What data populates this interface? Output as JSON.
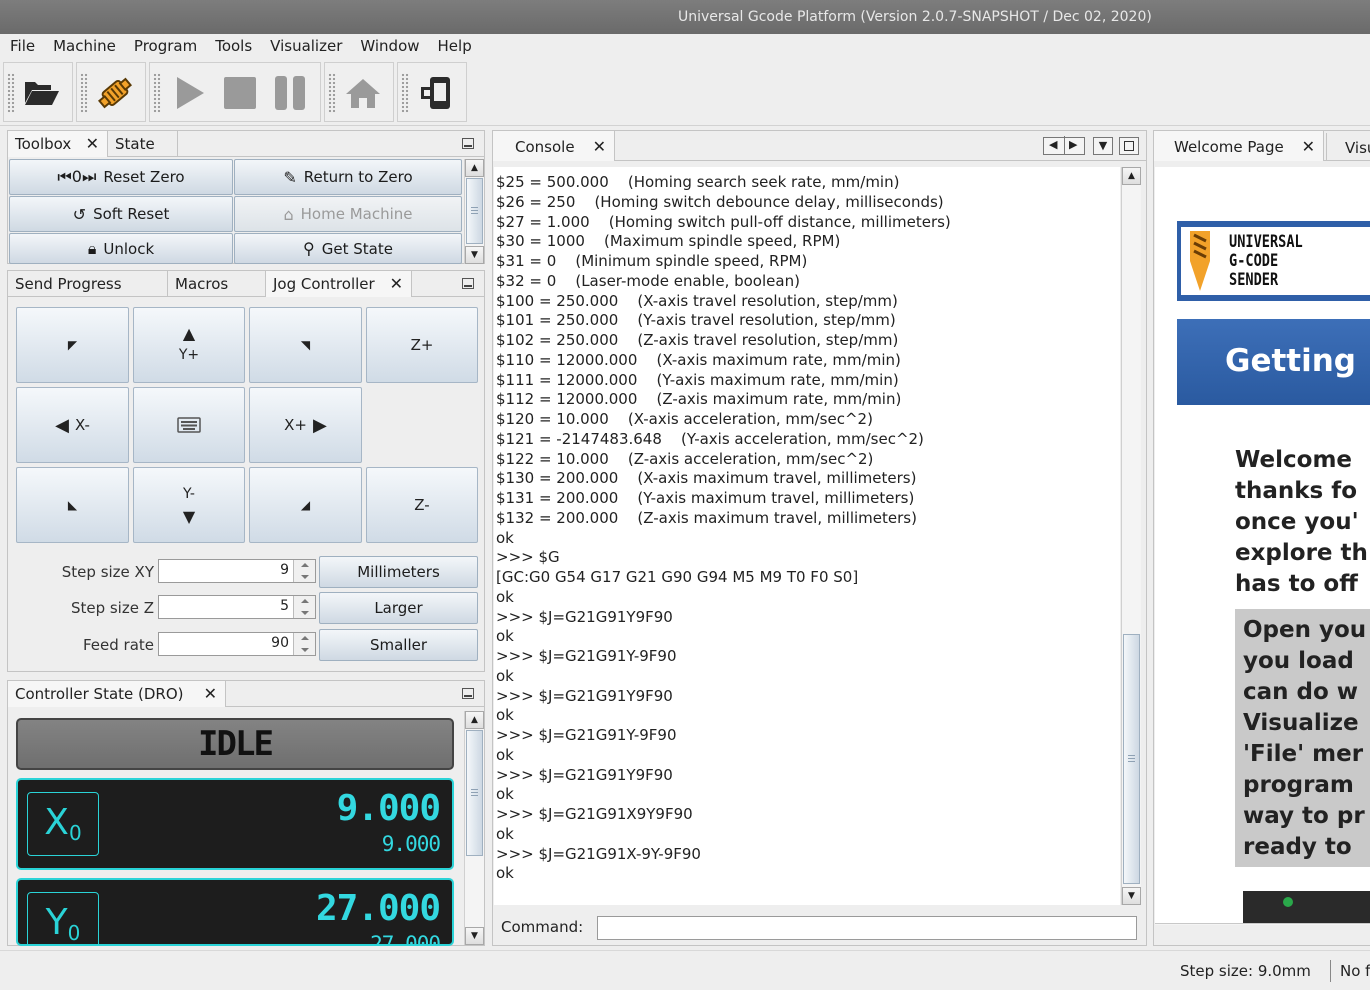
{
  "window": {
    "title": "Universal Gcode Platform (Version 2.0.7-SNAPSHOT / Dec 02, 2020)"
  },
  "menu": [
    "File",
    "Machine",
    "Program",
    "Tools",
    "Visualizer",
    "Window",
    "Help"
  ],
  "toolbar": {
    "icons": [
      "folder-open-icon",
      "connect-icon",
      "play-icon",
      "stop-icon",
      "pause-icon",
      "home-icon",
      "device-icon"
    ]
  },
  "toolbox": {
    "tabs": [
      "Toolbox",
      "State"
    ],
    "buttons": {
      "reset_zero": "Reset Zero",
      "return_to_zero": "Return to Zero",
      "soft_reset": "Soft Reset",
      "home_machine": "Home Machine",
      "unlock": "Unlock",
      "get_state": "Get State"
    }
  },
  "jog": {
    "tabs": [
      "Send Progress",
      "Macros",
      "Jog Controller"
    ],
    "labels": {
      "yplus": "Y+",
      "yminus": "Y-",
      "xminus": "X-",
      "xplus": "X+",
      "zplus": "Z+",
      "zminus": "Z-"
    },
    "step_xy_label": "Step size XY",
    "step_xy_value": "9",
    "step_z_label": "Step size Z",
    "step_z_value": "5",
    "feed_label": "Feed rate",
    "feed_value": "90",
    "unit_button": "Millimeters",
    "larger_button": "Larger",
    "smaller_button": "Smaller"
  },
  "dro": {
    "title": "Controller State (DRO)",
    "state": "IDLE",
    "x": {
      "name": "X",
      "sub": "0",
      "value": "9.000",
      "machine": "9.000"
    },
    "y": {
      "name": "Y",
      "sub": "0",
      "value": "27.000",
      "machine": "27.000"
    }
  },
  "console": {
    "tab": "Console",
    "command_label": "Command:",
    "lines": [
      "$25 = 500.000    (Homing search seek rate, mm/min)",
      "$26 = 250    (Homing switch debounce delay, milliseconds)",
      "$27 = 1.000    (Homing switch pull-off distance, millimeters)",
      "$30 = 1000    (Maximum spindle speed, RPM)",
      "$31 = 0    (Minimum spindle speed, RPM)",
      "$32 = 0    (Laser-mode enable, boolean)",
      "$100 = 250.000    (X-axis travel resolution, step/mm)",
      "$101 = 250.000    (Y-axis travel resolution, step/mm)",
      "$102 = 250.000    (Z-axis travel resolution, step/mm)",
      "$110 = 12000.000    (X-axis maximum rate, mm/min)",
      "$111 = 12000.000    (Y-axis maximum rate, mm/min)",
      "$112 = 12000.000    (Z-axis maximum rate, mm/min)",
      "$120 = 10.000    (X-axis acceleration, mm/sec^2)",
      "$121 = -2147483.648    (Y-axis acceleration, mm/sec^2)",
      "$122 = 10.000    (Z-axis acceleration, mm/sec^2)",
      "$130 = 200.000    (X-axis maximum travel, millimeters)",
      "$131 = 200.000    (Y-axis maximum travel, millimeters)",
      "$132 = 200.000    (Z-axis maximum travel, millimeters)",
      "ok",
      ">>> $G",
      "[GC:G0 G54 G17 G21 G90 G94 M5 M9 T0 F0 S0]",
      "ok",
      ">>> $J=G21G91Y9F90",
      "ok",
      ">>> $J=G21G91Y-9F90",
      "ok",
      ">>> $J=G21G91Y9F90",
      "ok",
      ">>> $J=G21G91Y-9F90",
      "ok",
      ">>> $J=G21G91Y9F90",
      "ok",
      ">>> $J=G21G91X9Y9F90",
      "ok",
      ">>> $J=G21G91X-9Y-9F90",
      "ok"
    ]
  },
  "welcome": {
    "tabs": [
      "Welcome Page",
      "Visu"
    ],
    "logo_lines": [
      "UNIVERSAL",
      "G-CODE",
      "SENDER"
    ],
    "heading": "Getting",
    "para1": [
      "Welcome",
      "thanks fo",
      "once you'",
      "explore th",
      "has to off"
    ],
    "para2": [
      "Open you",
      "you load",
      "can do w",
      "Visualize",
      "'File' mer",
      "program",
      "way to pr",
      "ready to"
    ]
  },
  "status": {
    "step_size": "Step size: 9.0mm",
    "extra": "No f"
  },
  "colors": {
    "dro_accent": "#2ad3d7",
    "button_top": "#f3f6f9",
    "button_bottom": "#cfd9e3",
    "banner_blue": "#2f5fa8"
  }
}
